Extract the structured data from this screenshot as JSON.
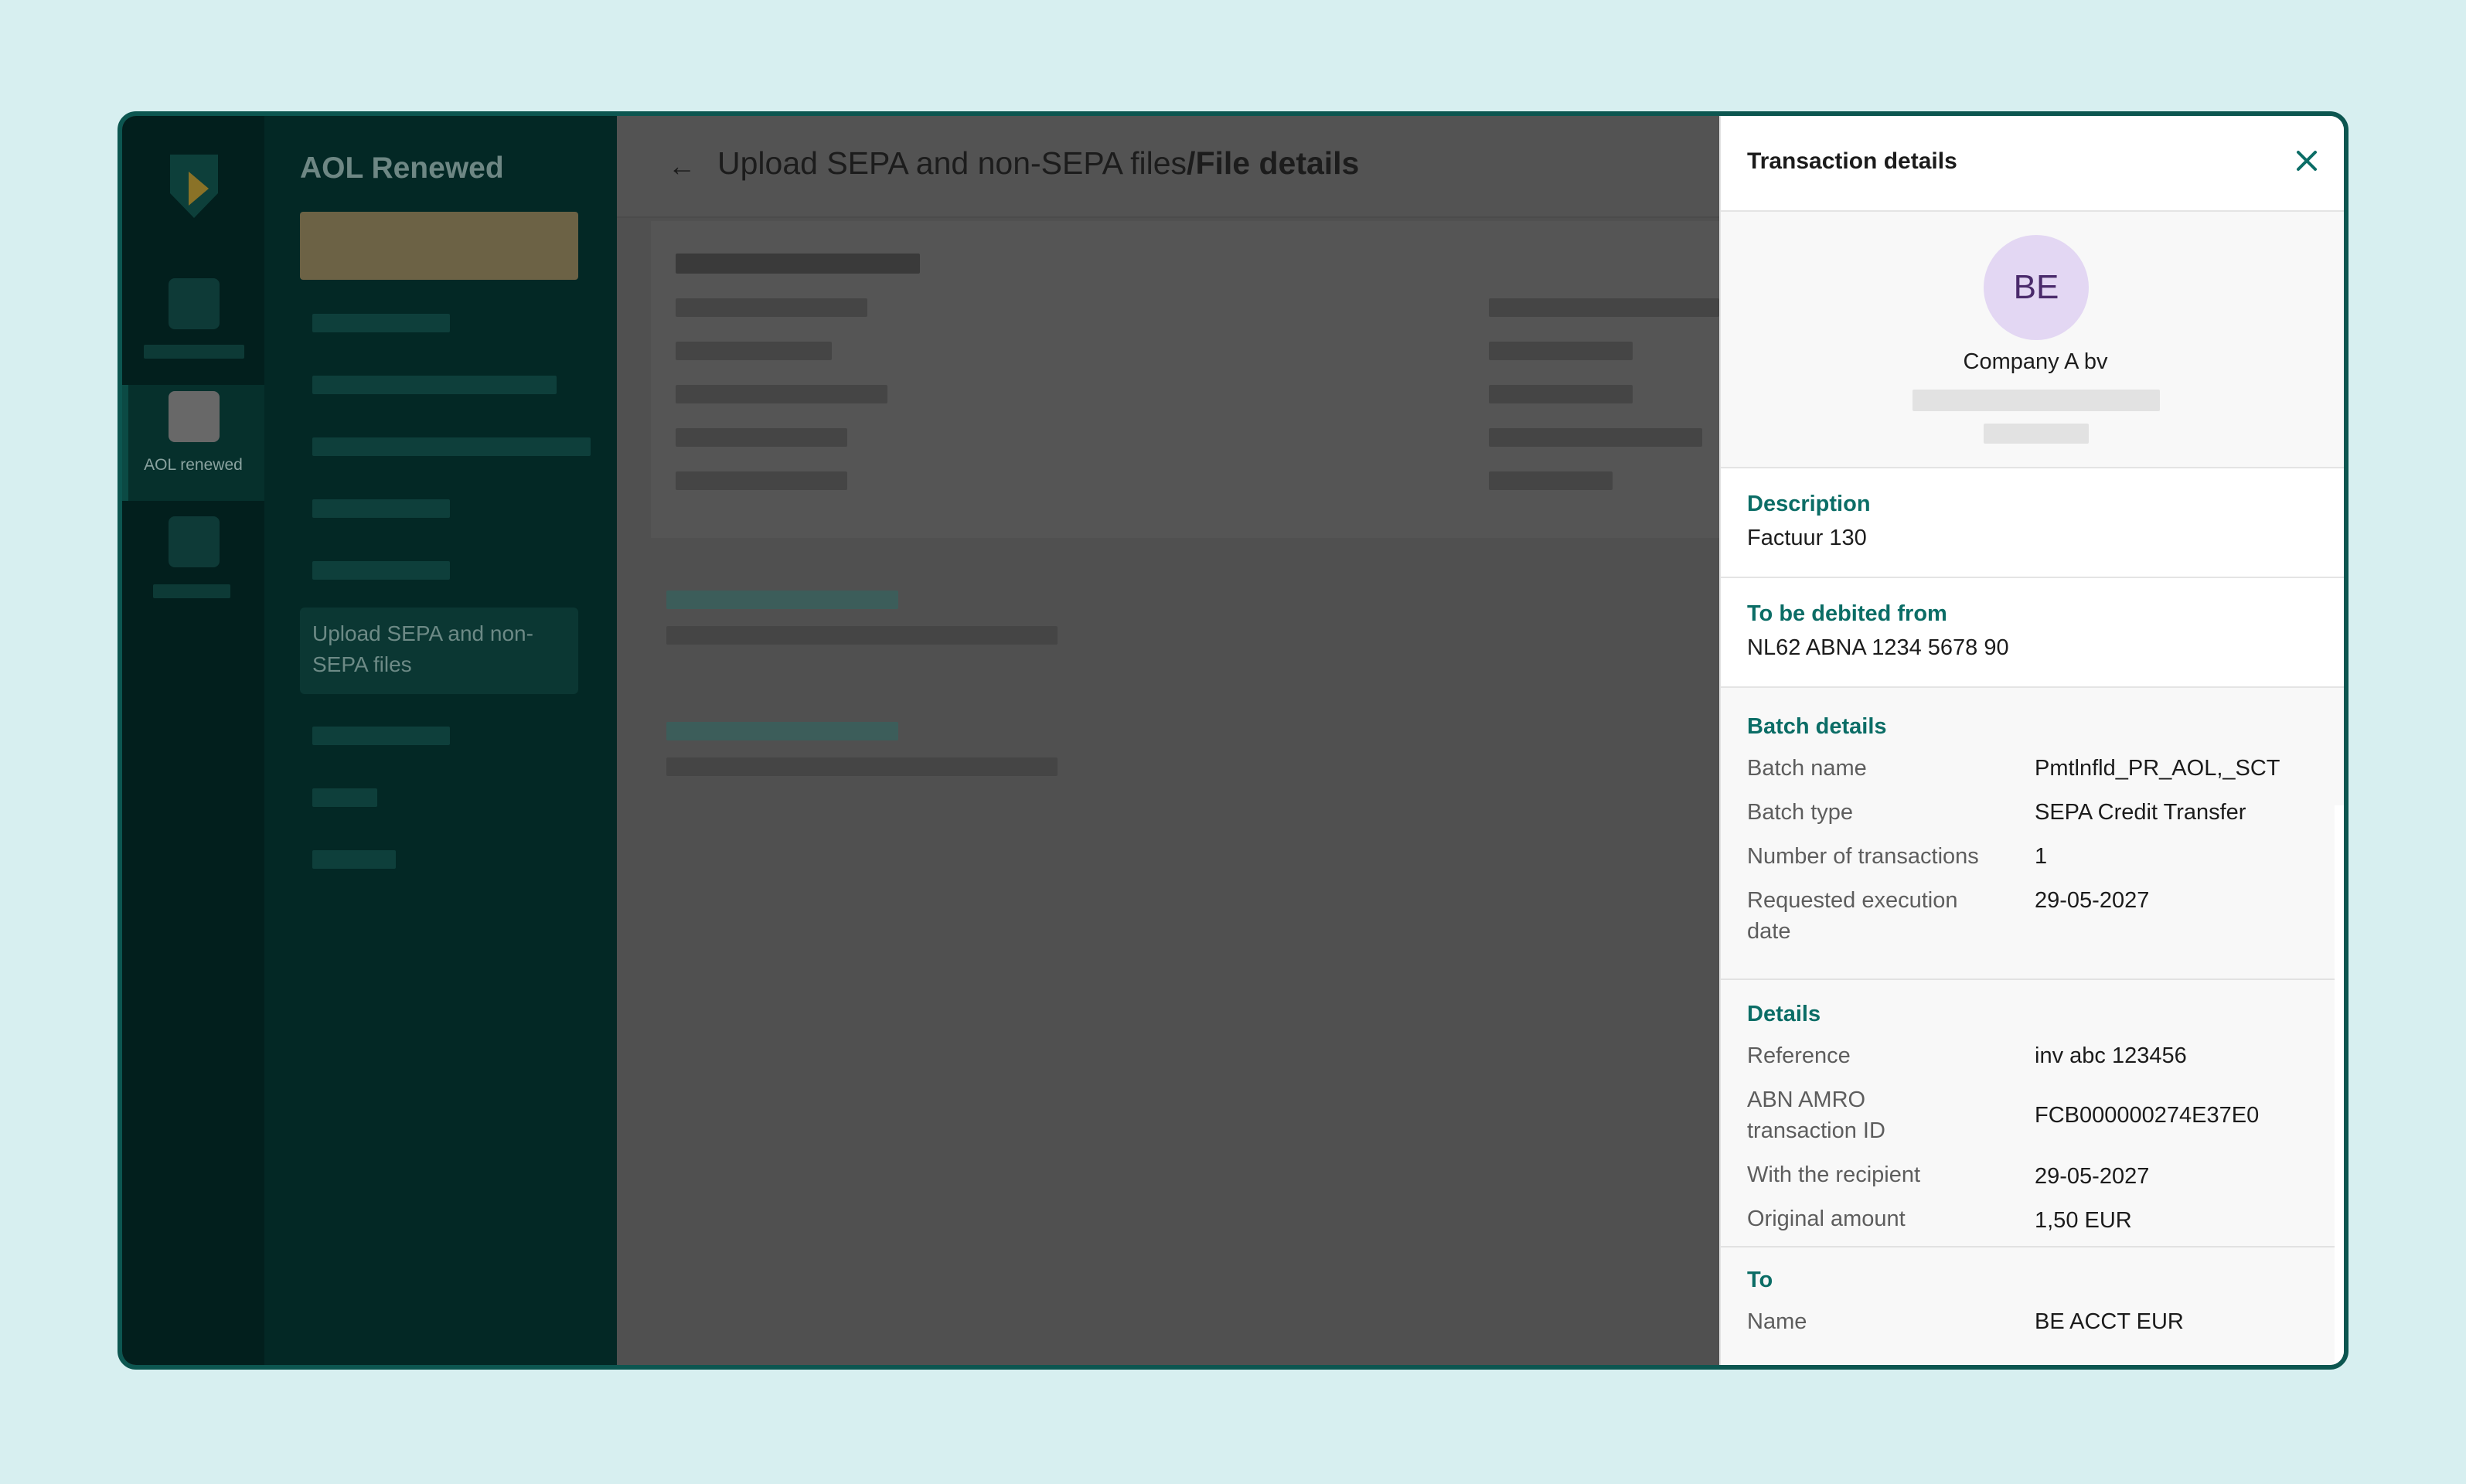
{
  "sidebar": {
    "app_title": "AOL Renewed",
    "active_rail_label": "AOL renewed",
    "active_nav_label": "Upload SEPA and non-SEPA files"
  },
  "header": {
    "back_icon": "arrow-left-icon",
    "crumb_parent": "Upload SEPA and non-SEPA files",
    "crumb_separator": "/",
    "crumb_current": "File details"
  },
  "panel": {
    "title": "Transaction details",
    "close_icon": "close-icon",
    "avatar_initials": "BE",
    "avatar_color": "#e3d7f3",
    "company": "Company A bv",
    "description": {
      "label": "Description",
      "value": "Factuur 130"
    },
    "debited": {
      "label": "To be debited from",
      "value": "NL62 ABNA 1234 5678 90"
    },
    "batch": {
      "title": "Batch details",
      "rows": [
        {
          "k": "Batch name",
          "v": "Pmtlnfld_PR_AOL,_SCT"
        },
        {
          "k": "Batch type",
          "v": "SEPA Credit Transfer"
        },
        {
          "k": "Number of transactions",
          "v": "1"
        },
        {
          "k": "Requested execution date",
          "v": "29-05-2027"
        }
      ]
    },
    "details": {
      "title": "Details",
      "rows": [
        {
          "k": "Reference",
          "v": "inv abc 123456"
        },
        {
          "k": "ABN AMRO transaction ID",
          "v": "FCB000000274E37E0"
        },
        {
          "k": "With the recipient",
          "v": "29-05-2027"
        },
        {
          "k": "Original amount",
          "v": "1,50 EUR"
        }
      ]
    },
    "to": {
      "title": "To",
      "rows": [
        {
          "k": "Name",
          "v": "BE ACCT EUR"
        }
      ]
    }
  },
  "colors": {
    "accent": "#0b6d66",
    "frame": "#0c5650",
    "background": "#d7eff0"
  }
}
